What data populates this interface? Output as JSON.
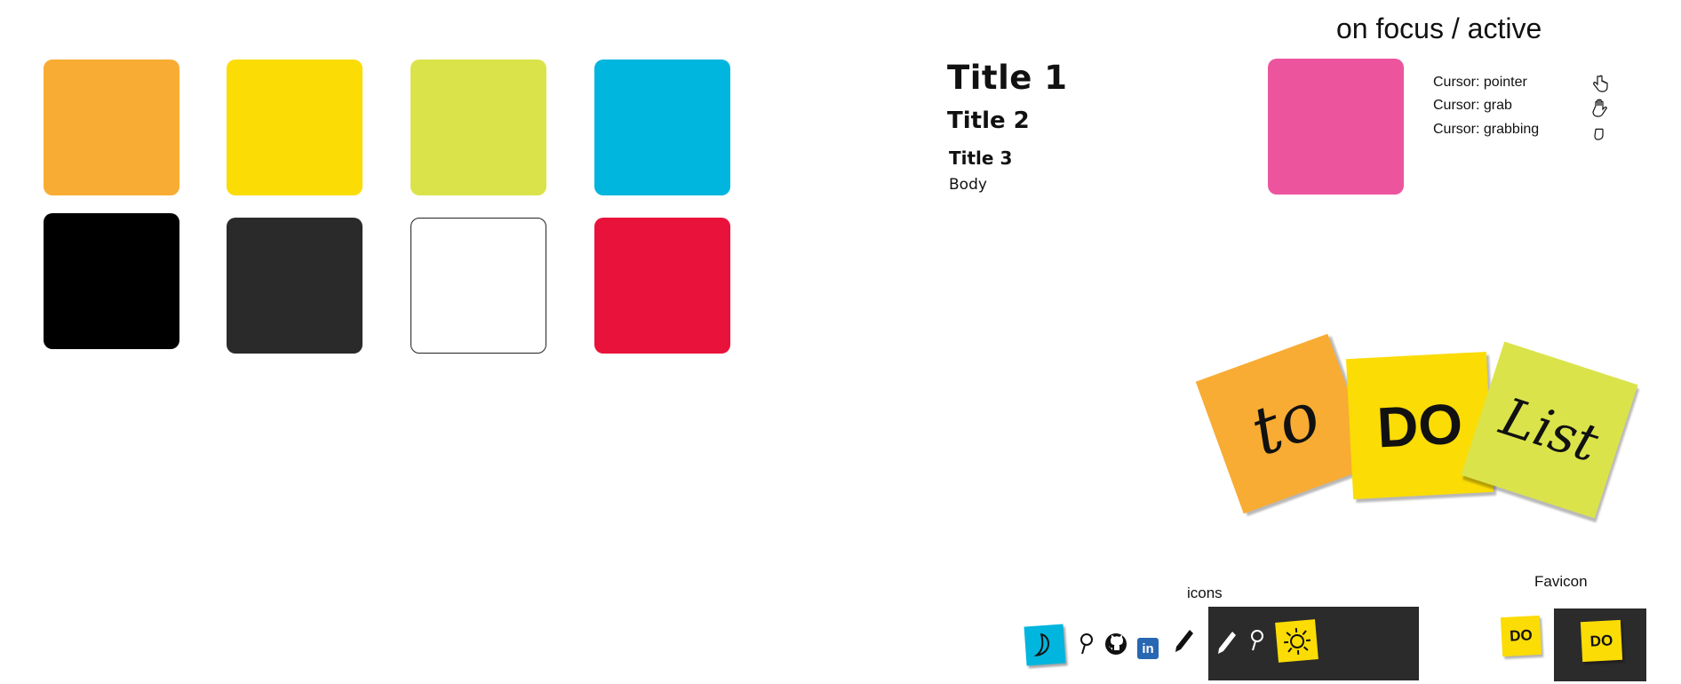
{
  "palette": {
    "orange": "#F8AC33",
    "yellow": "#FBDC05",
    "lime": "#DBE34B",
    "cyan": "#00B5DE",
    "black": "#000000",
    "charcoal": "#2A2A2A",
    "white": "#FFFFFF",
    "red": "#E8123B",
    "pink": "#EC559E"
  },
  "typography": {
    "title1": "Title 1",
    "title2": "Title 2",
    "title3": "Title 3",
    "body": "Body"
  },
  "focus": {
    "heading": "on focus / active",
    "cursors": [
      {
        "label": "Cursor: pointer",
        "icon": "pointer-hand-icon"
      },
      {
        "label": "Cursor: grab",
        "icon": "open-hand-icon"
      },
      {
        "label": "Cursor: grabbing",
        "icon": "closed-hand-icon"
      }
    ]
  },
  "logo": {
    "words": [
      "to",
      "DO",
      "List"
    ]
  },
  "icons": {
    "label": "icons",
    "light": [
      "moon-icon",
      "search-icon",
      "github-icon",
      "linkedin-icon",
      "pencil-icon"
    ],
    "dark": [
      "pencil-icon",
      "search-icon",
      "sun-icon"
    ]
  },
  "favicon": {
    "label": "Favicon",
    "text": "DO"
  }
}
